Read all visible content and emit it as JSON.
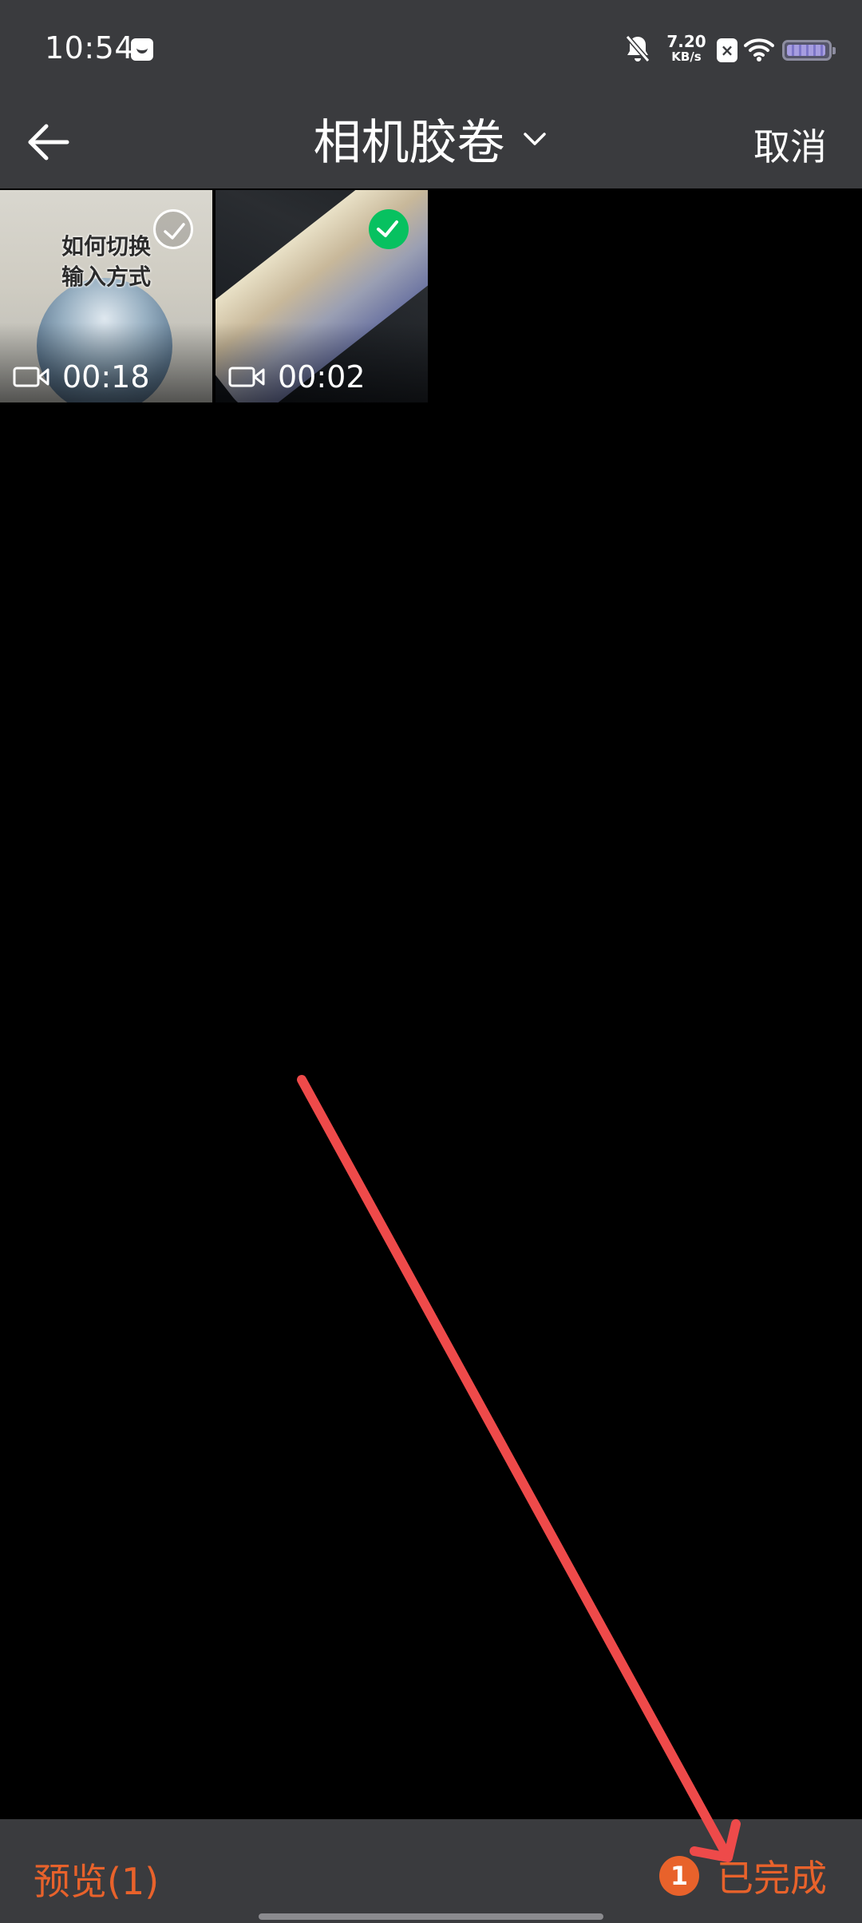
{
  "status_bar": {
    "time": "10:54",
    "net_speed_value": "7.20",
    "net_speed_unit": "KB/s",
    "icons": [
      "notification-icon",
      "mute-bell-icon",
      "x-app-icon",
      "wifi-icon",
      "battery-icon"
    ]
  },
  "header": {
    "title": "相机胶卷",
    "cancel_label": "取消",
    "icons": [
      "back-arrow-icon",
      "chevron-down-icon"
    ]
  },
  "media": [
    {
      "thumb_text_line1": "如何切换",
      "thumb_text_line2": "输入方式",
      "duration": "00:18",
      "selected": false
    },
    {
      "duration": "00:02",
      "selected": true
    }
  ],
  "bottom_bar": {
    "preview_label": "预览(1)",
    "selected_count": "1",
    "done_label": "已完成"
  },
  "colors": {
    "bar_background": "#3a3b3e",
    "accent_orange": "#e8622b",
    "check_green": "#07c160",
    "annotation_red": "#ee4a4a"
  }
}
